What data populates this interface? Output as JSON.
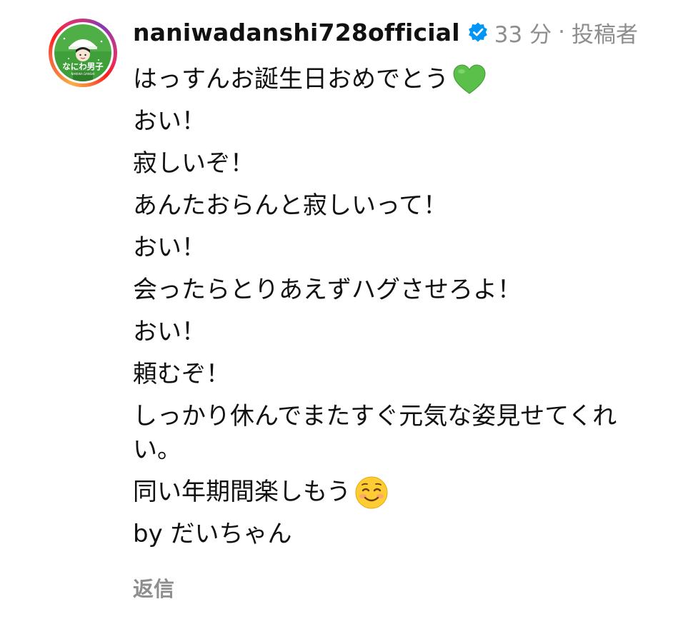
{
  "comment": {
    "username": "naniwadanshi728official",
    "time": "33 分",
    "separator": "·",
    "author_badge": "投稿者",
    "avatar_text": "なにわ男子",
    "avatar_subtext": "NANIWA DANSHI",
    "lines": {
      "l1": "はっすんお誕生日おめでとう",
      "l2": "おい！",
      "l3": "寂しいぞ！",
      "l4": "あんたおらんと寂しいって！",
      "l5": "おい！",
      "l6": "会ったらとりあえずハグさせろよ！",
      "l7": "おい！",
      "l8": "頼むぞ！",
      "l9": "しっかり休んでまたすぐ元気な姿見せてくれい。",
      "l10": "同い年期間楽しもう",
      "l11": "by だいちゃん"
    },
    "reply_label": "返信"
  },
  "icons": {
    "verified": "verified-badge-icon",
    "heart": "green-heart-emoji",
    "smile": "smiling-face-emoji"
  },
  "colors": {
    "verified_blue": "#0095f6",
    "meta_gray": "#8e8e8e",
    "heart_green": "#5ac04a",
    "avatar_green": "#3f9f3a"
  }
}
